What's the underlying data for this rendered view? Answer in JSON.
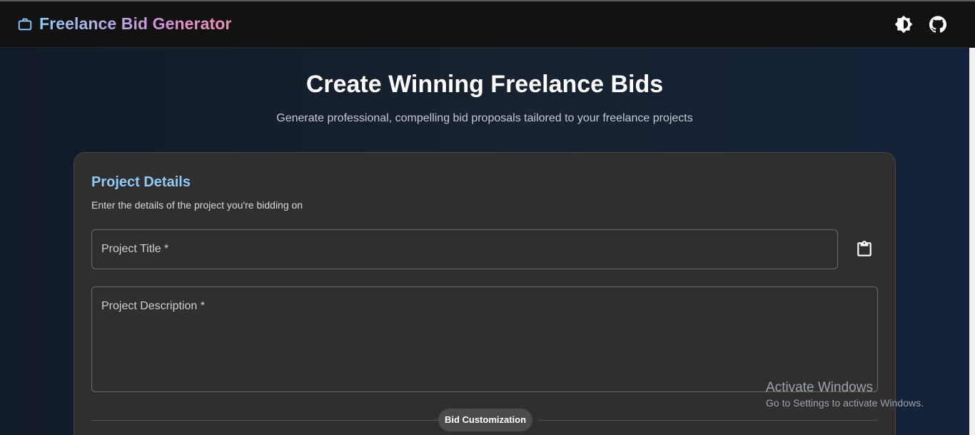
{
  "app": {
    "title": "Freelance Bid Generator",
    "brand_icon": "briefcase-icon",
    "accent": "#90caf9",
    "gradient": [
      "#90caf9",
      "#ce93d8",
      "#f48fb1"
    ],
    "actions": [
      {
        "name": "theme-toggle",
        "icon": "brightness-icon"
      },
      {
        "name": "github-link",
        "icon": "github-icon"
      }
    ]
  },
  "hero": {
    "title": "Create Winning Freelance Bids",
    "subtitle": "Generate professional, compelling bid proposals tailored to your freelance projects"
  },
  "project_details": {
    "title": "Project Details",
    "subtitle": "Enter the details of the project you're bidding on",
    "title_field": {
      "label": "Project Title *",
      "value": ""
    },
    "paste_icon": "clipboard-icon",
    "description_field": {
      "label": "Project Description *",
      "value": ""
    },
    "section_divider": "Bid Customization"
  },
  "watermark": {
    "title": "Activate Windows",
    "subtitle": "Go to Settings to activate Windows."
  }
}
